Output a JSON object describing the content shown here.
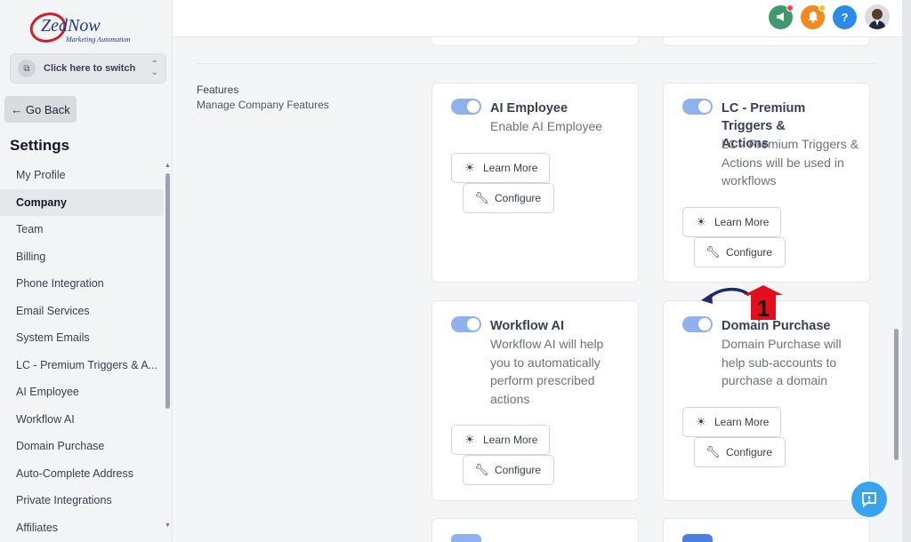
{
  "brand": {
    "logo_main": "ZedNow",
    "logo_sub": "Marketing Automation"
  },
  "switcher": {
    "label": "Click here to switch"
  },
  "goback": {
    "label": "Go Back"
  },
  "settings_title": "Settings",
  "nav": {
    "items": [
      {
        "label": "My Profile"
      },
      {
        "label": "Company"
      },
      {
        "label": "Team"
      },
      {
        "label": "Billing"
      },
      {
        "label": "Phone Integration"
      },
      {
        "label": "Email Services"
      },
      {
        "label": "System Emails"
      },
      {
        "label": "LC - Premium Triggers & A..."
      },
      {
        "label": "AI Employee"
      },
      {
        "label": "Workflow AI"
      },
      {
        "label": "Domain Purchase"
      },
      {
        "label": "Auto-Complete Address"
      },
      {
        "label": "Private Integrations"
      },
      {
        "label": "Affiliates"
      }
    ],
    "active": "Company"
  },
  "topbar": {
    "help_label": "?"
  },
  "section": {
    "title": "Features",
    "subtitle": "Manage Company Features"
  },
  "cards": [
    {
      "title": "AI Employee",
      "desc": "Enable AI Employee",
      "enabled": true,
      "learn_more": "Learn More",
      "configure": "Configure"
    },
    {
      "title": "LC - Premium Triggers & Actions",
      "desc": "LC - Premium Triggers & Actions will be used in workflows",
      "enabled": true,
      "learn_more": "Learn More",
      "configure": "Configure"
    },
    {
      "title": "Workflow AI",
      "desc": "Workflow AI will help you to automatically perform prescribed actions",
      "enabled": true,
      "learn_more": "Learn More",
      "configure": "Configure"
    },
    {
      "title": "Domain Purchase",
      "desc": "Domain Purchase will help sub-accounts to purchase a domain",
      "enabled": true,
      "learn_more": "Learn More",
      "configure": "Configure"
    }
  ],
  "annotation": {
    "step": "1"
  },
  "colors": {
    "toggle_on": "#8fb1ee",
    "announce": "#3e9a6e",
    "bell": "#f28a1f",
    "help": "#2b8be6",
    "chat": "#3aa3f0",
    "annotation_red": "#e3101b",
    "annotation_arrow": "#1e2a6e"
  },
  "icons": {
    "learn_more": "lightbulb-icon",
    "configure": "wrench-icon",
    "chat": "chat-icon"
  }
}
